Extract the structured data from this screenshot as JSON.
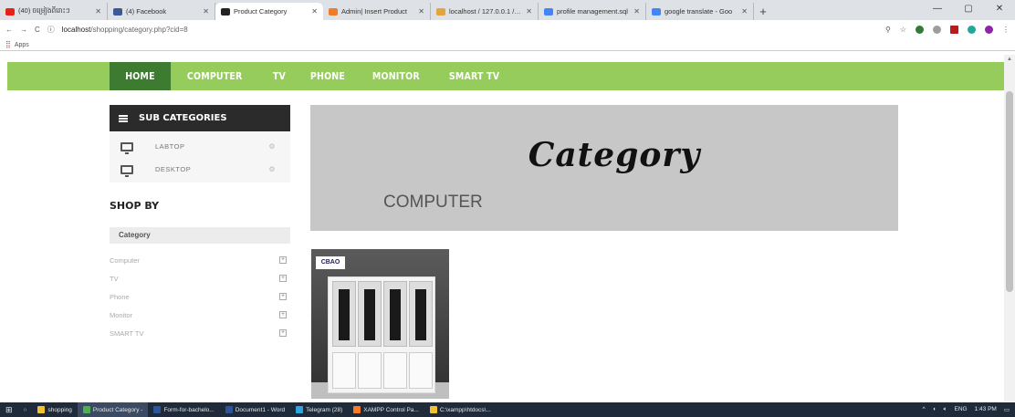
{
  "browser": {
    "tabs": [
      {
        "title": "(40) ចម្រៀងពីរោះៗ",
        "color": "#e62117",
        "active": false
      },
      {
        "title": "(4) Facebook",
        "color": "#3b5998",
        "active": false
      },
      {
        "title": "Product Category",
        "color": "#222222",
        "active": true
      },
      {
        "title": "Admin| Insert Product",
        "color": "#f07c2a",
        "active": false
      },
      {
        "title": "localhost / 127.0.0.1 / sh",
        "color": "#e2a43c",
        "active": false
      },
      {
        "title": "profile management.sql",
        "color": "#4285f4",
        "active": false
      },
      {
        "title": "google translate - Goo",
        "color": "#4285f4",
        "active": false
      }
    ],
    "new_tab": "+",
    "window_controls": [
      "—",
      "▢",
      "✕"
    ],
    "url_host": "localhost",
    "url_path": "/shopping/category.php?cid=8",
    "bookmarks_label": "Apps"
  },
  "nav": {
    "items": [
      "HOME",
      "COMPUTER",
      "TV",
      "PHONE",
      "MONITOR",
      "SMART TV"
    ],
    "active_index": 0
  },
  "sidebar": {
    "sub_title": "SUB CATEGORIES",
    "sub_items": [
      "LABTOP",
      "DESKTOP"
    ],
    "shop_by": "SHOP BY",
    "category_header": "Category",
    "categories": [
      "Computer",
      "TV",
      "Phone",
      "Monitor",
      "SMART TV"
    ]
  },
  "banner": {
    "title": "Category",
    "subtitle": "COMPUTER"
  },
  "product": {
    "logo_text": "CBAO"
  },
  "taskbar": {
    "items": [
      {
        "label": "shopping",
        "color": "#f2c12e",
        "hi": false
      },
      {
        "label": "Product Category -",
        "color": "#4caf50",
        "hi": true
      },
      {
        "label": "Form-for-bachelo...",
        "color": "#2b579a",
        "hi": false
      },
      {
        "label": "Document1 - Word",
        "color": "#2b579a",
        "hi": false
      },
      {
        "label": "Telegram (28)",
        "color": "#2ca5e0",
        "hi": false
      },
      {
        "label": "XAMPP Control Pa...",
        "color": "#fb7a24",
        "hi": false
      },
      {
        "label": "C:\\xampp\\htdocs\\...",
        "color": "#f2c12e",
        "hi": false
      }
    ],
    "lang": "ENG",
    "time": "1:43 PM"
  }
}
